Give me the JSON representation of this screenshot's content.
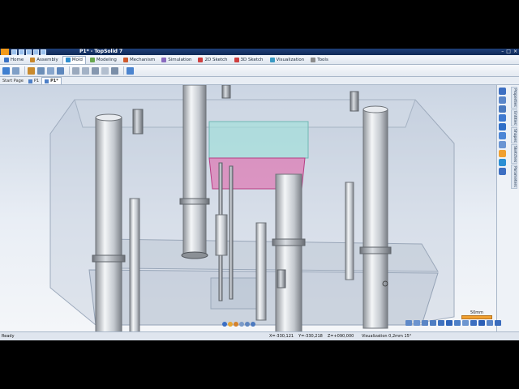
{
  "window": {
    "title": "P1* - TopSolid 7"
  },
  "window_controls": [
    "–",
    "□",
    "×"
  ],
  "menu_tabs": [
    {
      "label": "Home",
      "color": "#3a72c4"
    },
    {
      "label": "Assembly",
      "color": "#c9882b"
    },
    {
      "label": "Mold",
      "color": "#2f8fd1"
    },
    {
      "label": "Modeling",
      "color": "#6aa84f"
    },
    {
      "label": "Mechanism",
      "color": "#d05a2d"
    },
    {
      "label": "Simulation",
      "color": "#8a6bbf"
    },
    {
      "label": "2D Sketch",
      "color": "#cf3f3f"
    },
    {
      "label": "3D Sketch",
      "color": "#cf3f3f"
    },
    {
      "label": "Visualization",
      "color": "#3a9bc4"
    },
    {
      "label": "Tools",
      "color": "#8c8c8c"
    }
  ],
  "doc_tabs": [
    {
      "label": "Start Page"
    },
    {
      "label": "P1"
    },
    {
      "label": "P1*"
    }
  ],
  "side_tabs": [
    "Properties",
    "Entities",
    "Shapes",
    "Sketches",
    "Parameters"
  ],
  "scale": {
    "label": "50mm"
  },
  "status": {
    "ready": "Ready",
    "x": "X=-330,121",
    "y": "Y=-330,218",
    "z": "Z=+090,000",
    "visualization": "Visualization 0,2mm 15°"
  },
  "colors": {
    "titlebar": "#14305f",
    "accent": "#f39a1c",
    "plate_pink": "#e15ba4",
    "plate_cyan": "#9fe0da"
  }
}
